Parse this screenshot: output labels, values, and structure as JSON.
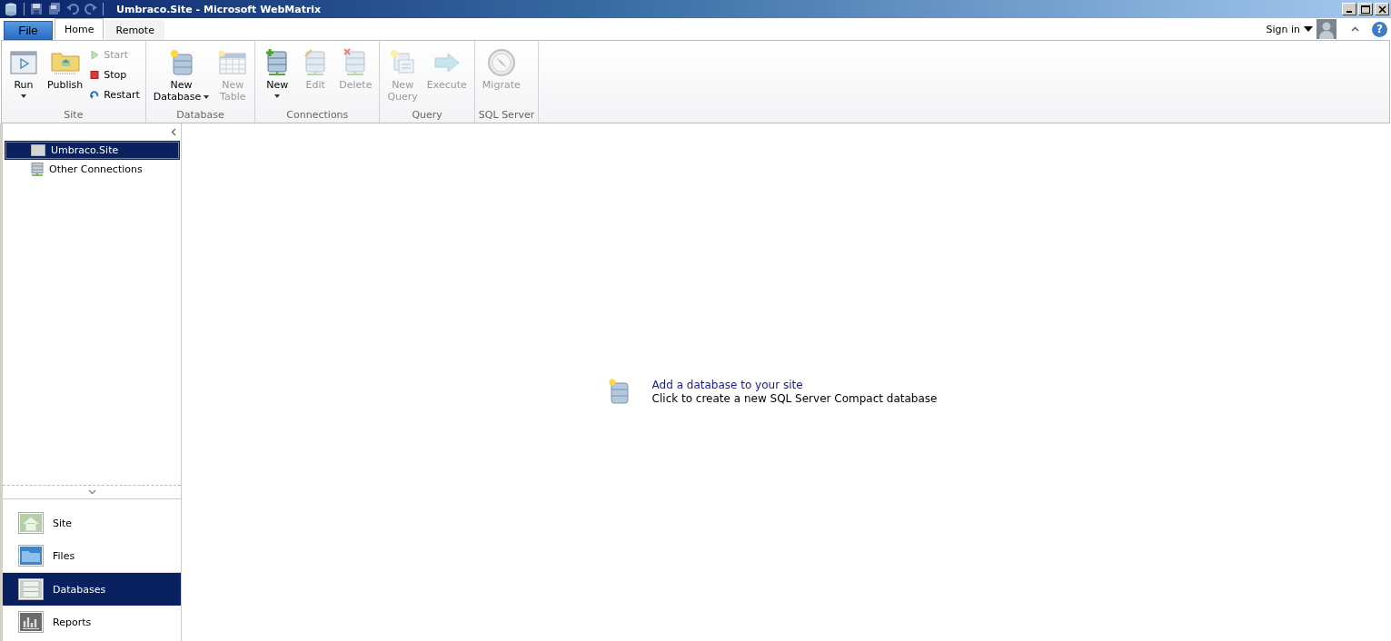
{
  "window": {
    "title": "Umbraco.Site - Microsoft WebMatrix"
  },
  "tabs": [
    {
      "label": "File",
      "kind": "file",
      "selected": false
    },
    {
      "label": "Home",
      "kind": "tab",
      "selected": true
    },
    {
      "label": "Remote",
      "kind": "tab",
      "selected": false
    }
  ],
  "account": {
    "sign_in": "Sign in",
    "help": "?"
  },
  "ribbon_groups": [
    {
      "label": "Site",
      "buttons": [
        {
          "kind": "large",
          "lines": [
            "Run"
          ],
          "dropdown": true,
          "disabled": false
        },
        {
          "kind": "large",
          "lines": [
            "Publish"
          ],
          "dropdown": false,
          "disabled": false
        },
        {
          "kind": "small",
          "lines": [
            "Start"
          ],
          "disabled": true
        },
        {
          "kind": "small",
          "lines": [
            "Stop"
          ],
          "disabled": false
        },
        {
          "kind": "small",
          "lines": [
            "Restart"
          ],
          "disabled": false
        }
      ]
    },
    {
      "label": "Database",
      "buttons": [
        {
          "kind": "large",
          "lines": [
            "New",
            "Database"
          ],
          "dropdown": true,
          "disabled": false
        },
        {
          "kind": "large",
          "lines": [
            "New",
            "Table"
          ],
          "dropdown": false,
          "disabled": true
        }
      ]
    },
    {
      "label": "Connections",
      "buttons": [
        {
          "kind": "large",
          "lines": [
            "New"
          ],
          "dropdown": true,
          "disabled": false
        },
        {
          "kind": "large",
          "lines": [
            "Edit"
          ],
          "dropdown": false,
          "disabled": true
        },
        {
          "kind": "large",
          "lines": [
            "Delete"
          ],
          "dropdown": false,
          "disabled": true
        }
      ]
    },
    {
      "label": "Query",
      "buttons": [
        {
          "kind": "large",
          "lines": [
            "New",
            "Query"
          ],
          "dropdown": false,
          "disabled": true
        },
        {
          "kind": "large",
          "lines": [
            "Execute"
          ],
          "dropdown": false,
          "disabled": true
        }
      ]
    },
    {
      "label": "SQL Server",
      "buttons": [
        {
          "kind": "large",
          "lines": [
            "Migrate"
          ],
          "dropdown": false,
          "disabled": true
        }
      ]
    }
  ],
  "tree": [
    {
      "label": "Umbraco.Site",
      "selected": true
    },
    {
      "label": "Other Connections",
      "selected": false
    }
  ],
  "workspaces": [
    {
      "label": "Site",
      "selected": false
    },
    {
      "label": "Files",
      "selected": false
    },
    {
      "label": "Databases",
      "selected": true
    },
    {
      "label": "Reports",
      "selected": false
    }
  ],
  "empty_state": {
    "title": "Add a database to your site",
    "description": "Click to create a new SQL Server Compact database"
  }
}
